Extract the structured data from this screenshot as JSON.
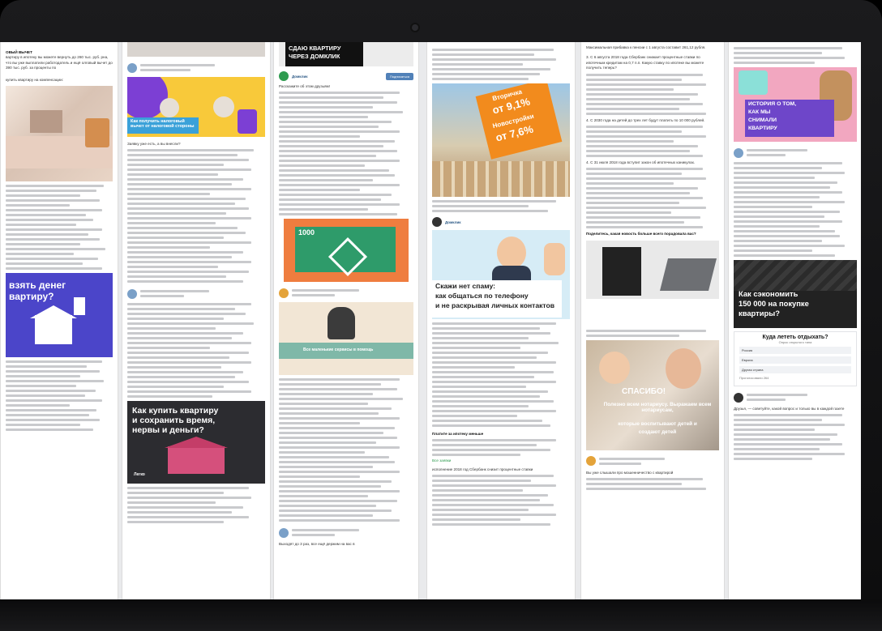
{
  "col1": {
    "heading": "ОВЫЙ ВЫЧЕТ",
    "intro": "вартиру в ипотеку вы можете вернуть до 260 тыс. руб. рна, что вы уже выплатили работодатель и ещё олговый вычет до 390 тыс. руб. за проценты по",
    "line2": "купить квартиру на компенсации:",
    "banner": [
      "взять денег",
      "вартиру?"
    ]
  },
  "col2": {
    "banner1": "Как получить налоговый вычет от налоговой стороны",
    "lead": "Заявку уже есть, а вы внесли?",
    "banner2": [
      "Как купить квартиру",
      "и сохранить время,",
      "нервы и деньги?"
    ],
    "banner2_tag": "Легко"
  },
  "col3": {
    "banner_top": [
      "СДАЮ КВАРТИРУ",
      "ЧЕРЕЗ ДОМКЛИК"
    ],
    "post_name": "Домклик",
    "join_label": "Подписаться",
    "lead": "Расскажите об этом друзьям!",
    "card_label": "1000",
    "photo_caption": "Все маленькие сервисы в помощь",
    "last_line": "Выходят до 3 раз, все ещё держим на вас в"
  },
  "col4": {
    "banner_lines": [
      "Вторичка",
      "от 9,1%",
      "Новостройки",
      "от 7,6%"
    ],
    "post_name": "Домклик",
    "title_lines": [
      "Скажи нет спаму:",
      "как общаться по телефону",
      "и не раскрывая личных контактов"
    ],
    "subheading": "Платите за ипотеку меньше",
    "highlight": "Все заявки",
    "last_line": "исполнение 2018 год Сбербанк снизит процентные ставки"
  },
  "col5": {
    "top": "Максимальная прибавка к пенсии с 1 августа составит 261,12 рубля.",
    "p1": "3. С 6 августа 2018 года Сбербанк снижает процентные ставки по ипотечным кредитам на 0,7 п.п. Какую ставку по ипотеке вы можете получить теперь?",
    "p2": "4. С 2030 года на детей до трех лет будут платить по 10 000 рублей.",
    "p3": "4. С 31 июля 2018 года вступит закон об ипотечных каникулах.",
    "question": "Поделитесь, какая новость больше всего порадовала вас?",
    "banner": [
      "СПАСИБО!",
      "Полезно всем нотариусу. Выражаем всем нотариусам,",
      "которые воспитывают детей и",
      "создают детей"
    ],
    "last_line": "Вы уже слышали про мошенничество с квартирой"
  },
  "col6": {
    "banner1": [
      "ИСТОРИЯ О ТОМ,",
      "КАК МЫ",
      "СНИМАЛИ",
      "КВАРТИРУ"
    ],
    "banner2": [
      "Как сэкономить",
      "150 000 на покупке",
      "квартиры?"
    ],
    "poll_title": "Куда лететь отдыхать?",
    "poll_sub": "Опрос открытого типа",
    "poll_options": [
      "Россия",
      "Европа",
      "Другая страна"
    ],
    "poll_footer": "Проголосовали 264",
    "last_line": "Друзья, — советуйте, какой вопрос и только вы в каждой газете"
  }
}
